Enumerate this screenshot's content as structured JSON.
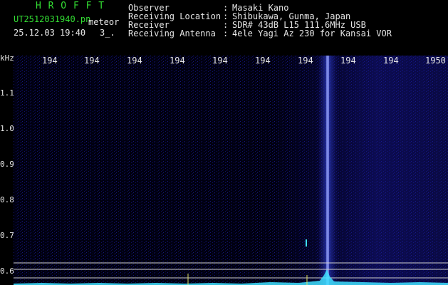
{
  "header": {
    "program": "H R O F F T",
    "filename": "UT2512031940.pn",
    "mode": "meteor",
    "datetime": "25.12.03 19:40",
    "extra": "3_.",
    "info": [
      {
        "key": "Observer",
        "sep": ":",
        "value": "Masaki Kano"
      },
      {
        "key": "Receiving Location",
        "sep": ":",
        "value": "Shibukawa, Gunma, Japan"
      },
      {
        "key": "Receiver",
        "sep": ":",
        "value": "SDR# 43dB L15 111.6MHz USB"
      },
      {
        "key": "Receiving Antenna",
        "sep": ":",
        "value": "4ele Yagi Az 230 for Kansai VOR"
      }
    ]
  },
  "yaxis": {
    "unit": "kHz",
    "ticks": [
      "1.1",
      "1.0",
      "0.9",
      "0.8",
      "0.7",
      "0.6"
    ]
  },
  "xaxis": {
    "ticks": [
      "194",
      "194",
      "194",
      "194",
      "194",
      "194",
      "194",
      "194",
      "194",
      "1950"
    ]
  },
  "colors": {
    "background": "#000010",
    "noise_low": "#101070",
    "noise_high": "#3a4ad0",
    "signal": "#aab4ff",
    "peak": "#40e0ff",
    "text_green": "#33dd33",
    "text_white": "#e6e6e6"
  }
}
